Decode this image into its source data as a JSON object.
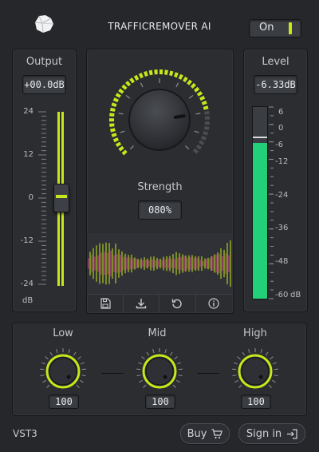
{
  "header": {
    "title": "TRAFFICREMOVER AI",
    "power_label": "On",
    "logo": "crumpled-paper-logo"
  },
  "output": {
    "label": "Output",
    "value": "+00.0dB",
    "scale": [
      "24",
      "12",
      "0",
      "-12",
      "-24"
    ],
    "unit": "dB",
    "fader_level_db": 0
  },
  "center": {
    "knob_label": "Strength",
    "strength_value": "080%",
    "strength_fraction": 0.8,
    "toolbar": [
      "save-icon",
      "download-icon",
      "undo-icon",
      "info-icon"
    ]
  },
  "level": {
    "label": "Level",
    "value": "-6.33dB",
    "scale": [
      "6",
      "0",
      "-6",
      "-12",
      "-24",
      "-36",
      "-48",
      "-60"
    ],
    "unit": "dB",
    "meter_db": -6.33
  },
  "eq": {
    "bands": [
      {
        "label": "Low",
        "value": "100"
      },
      {
        "label": "Mid",
        "value": "100"
      },
      {
        "label": "High",
        "value": "100"
      }
    ]
  },
  "footer": {
    "format": "VST3",
    "buy_label": "Buy",
    "signin_label": "Sign in"
  },
  "colors": {
    "accent": "#c8e61c",
    "meter": "#22d07a",
    "background": "#26272b",
    "waveform": "#c8e61c",
    "waveform_alt": "#d7467e"
  }
}
